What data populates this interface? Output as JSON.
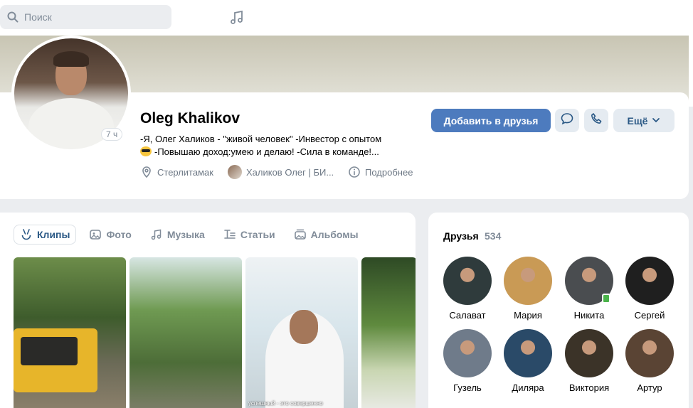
{
  "search": {
    "placeholder": "Поиск"
  },
  "profile": {
    "name": "Oleg Khalikov",
    "last_seen": "7 ч",
    "status_line1": "-Я, Олег Халиков - \"живой человек\" -Инвестор с опытом",
    "status_line2": "-Повышаю доход:умею и делаю! -Сила в команде!...",
    "city": "Стерлитамак",
    "work": "Халиков Олег | БИ...",
    "more_info": "Подробнее"
  },
  "actions": {
    "add_friend": "Добавить в друзья",
    "more": "Ещё"
  },
  "media_tabs": [
    {
      "label": "Клипы",
      "icon": "clips-icon"
    },
    {
      "label": "Фото",
      "icon": "photo-icon"
    },
    {
      "label": "Музыка",
      "icon": "music-icon"
    },
    {
      "label": "Статьи",
      "icon": "articles-icon"
    },
    {
      "label": "Альбомы",
      "icon": "albums-icon"
    }
  ],
  "clips": [
    {
      "caption": ""
    },
    {
      "caption": ""
    },
    {
      "caption": "успешный - это совершенно"
    },
    {
      "caption": ""
    }
  ],
  "friends": {
    "title": "Друзья",
    "count": "534",
    "items": [
      {
        "name": "Салават",
        "color": "#2f3b3c"
      },
      {
        "name": "Мария",
        "color": "#c99a55"
      },
      {
        "name": "Никита",
        "color": "#4a4d50"
      },
      {
        "name": "Сергей",
        "color": "#1f1f1f"
      },
      {
        "name": "Гузель",
        "color": "#6f7b8a"
      },
      {
        "name": "Диляра",
        "color": "#2a4a68"
      },
      {
        "name": "Виктория",
        "color": "#3b3328"
      },
      {
        "name": "Артур",
        "color": "#5a4434"
      }
    ]
  },
  "colors": {
    "accent": "#4d7bbe",
    "link": "#2a5885",
    "muted": "#818c99",
    "online": "#4bb34b"
  }
}
